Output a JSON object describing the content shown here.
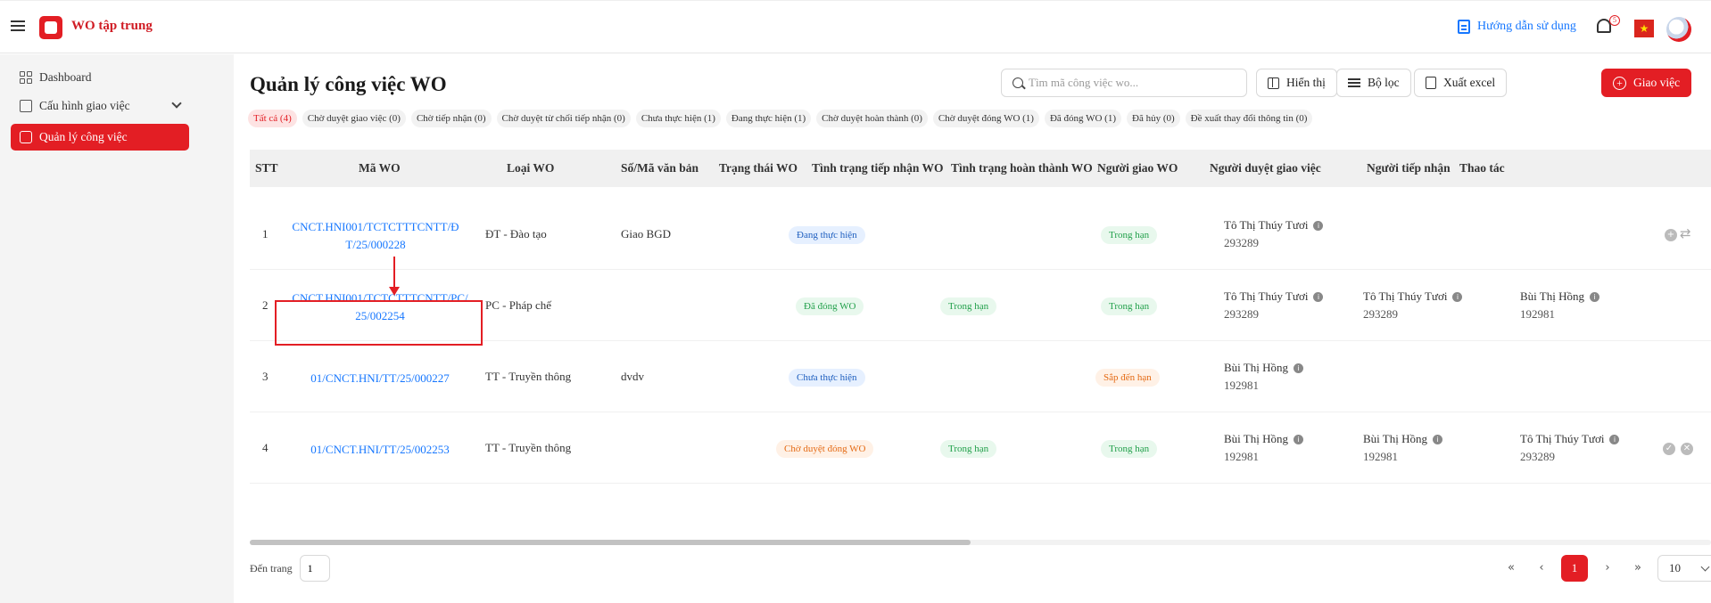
{
  "header": {
    "app_title": "WO tập trung",
    "help_label": "Hướng dẫn sử dụng",
    "notification_count": "5",
    "flag_star": "★"
  },
  "sidebar": {
    "items": [
      {
        "label": "Dashboard"
      },
      {
        "label": "Cấu hình giao việc"
      },
      {
        "label": "Quản lý công việc"
      }
    ]
  },
  "page": {
    "title": "Quản lý công việc WO"
  },
  "search": {
    "placeholder": "Tìm mã công việc wo..."
  },
  "toolbar": {
    "display_label": "Hiển thị",
    "filter_label": "Bộ lọc",
    "export_label": "Xuất excel",
    "assign_label": "Giao việc",
    "assign_icon": "+"
  },
  "tabs": [
    "Tất cả (4)",
    "Chờ duyệt giao việc (0)",
    "Chờ tiếp nhận (0)",
    "Chờ duyệt từ chối tiếp nhận (0)",
    "Chưa thực hiện (1)",
    "Đang thực hiện (1)",
    "Chờ duyệt hoàn thành (0)",
    "Chờ duyệt đóng WO (1)",
    "Đã đóng WO (1)",
    "Đã hủy (0)",
    "Đề xuất thay đổi thông tin (0)"
  ],
  "table": {
    "columns": [
      "STT",
      "Mã WO",
      "Loại WO",
      "Số/Mã văn bản",
      "Trạng thái WO",
      "Tình trạng tiếp nhận WO",
      "Tình trạng hoàn thành WO",
      "Người giao WO",
      "Người duyệt giao việc",
      "Người tiếp nhận",
      "Thao tác"
    ],
    "info_glyph": "i",
    "rows": [
      {
        "stt": "1",
        "code": "CNCT.HNI001/TCTCTTTCNTT/ĐT/25/000228",
        "type": "ĐT - Đào tạo",
        "doc": "Giao BGD",
        "status": "Đang thực hiện",
        "receive": "",
        "complete": "Trong hạn",
        "assigner_name": "Tô Thị Thúy Tươi",
        "assigner_id": "293289",
        "approver_name": "",
        "approver_id": "",
        "receiver_name": "",
        "receiver_id": ""
      },
      {
        "stt": "2",
        "code": "CNCT.HNI001/TCTCTTTCNTT/PC/25/002254",
        "type": "PC - Pháp chế",
        "doc": "",
        "status": "Đã đóng WO",
        "receive": "Trong hạn",
        "complete": "Trong hạn",
        "assigner_name": "Tô Thị Thúy Tươi",
        "assigner_id": "293289",
        "approver_name": "Tô Thị Thúy Tươi",
        "approver_id": "293289",
        "receiver_name": "Bùi Thị Hồng",
        "receiver_id": "192981"
      },
      {
        "stt": "3",
        "code": "01/CNCT.HNI/TT/25/000227",
        "type": "TT - Truyền thông",
        "doc": "dvdv",
        "status": "Chưa thực hiện",
        "receive": "",
        "complete": "Sắp đến hạn",
        "assigner_name": "Bùi Thị Hồng",
        "assigner_id": "192981",
        "approver_name": "",
        "approver_id": "",
        "receiver_name": "",
        "receiver_id": ""
      },
      {
        "stt": "4",
        "code": "01/CNCT.HNI/TT/25/002253",
        "type": "TT - Truyền thông",
        "doc": "",
        "status": "Chờ duyệt đóng WO",
        "receive": "Trong hạn",
        "complete": "Trong hạn",
        "assigner_name": "Bùi Thị Hồng",
        "assigner_id": "192981",
        "approver_name": "Bùi Thị Hồng",
        "approver_id": "192981",
        "receiver_name": "Tô Thị Thúy Tươi",
        "receiver_id": "293289"
      }
    ],
    "actions": {
      "plus_glyph": "+",
      "swap_glyph": "⇄",
      "check_glyph": "✓",
      "close_glyph": "✕"
    }
  },
  "pagination": {
    "goto_label": "Đến trang",
    "goto_value": "1",
    "first": "«",
    "prev": "‹",
    "current": "1",
    "next": "›",
    "last": "»",
    "page_size": "10"
  }
}
